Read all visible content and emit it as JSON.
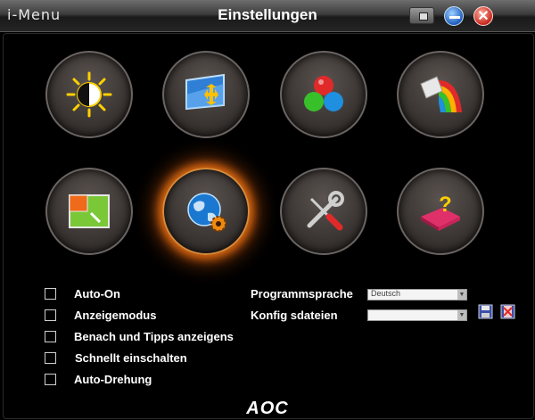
{
  "window": {
    "app_name": "i-Menu",
    "title": "Einstellungen",
    "close_glyph": "✕"
  },
  "tiles": [
    {
      "icon": "brightness-icon"
    },
    {
      "icon": "picture-boost-icon"
    },
    {
      "icon": "color-balls-icon"
    },
    {
      "icon": "color-paint-icon"
    },
    {
      "icon": "pip-window-icon"
    },
    {
      "icon": "globe-gear-icon",
      "active": true
    },
    {
      "icon": "tools-icon"
    },
    {
      "icon": "help-book-icon"
    }
  ],
  "checkboxes": [
    {
      "label": "Auto-On",
      "checked": false
    },
    {
      "label": "Anzeigemodus",
      "checked": false
    },
    {
      "label": "Benach und Tipps anzeigens",
      "checked": false
    },
    {
      "label": "Schnellt einschalten",
      "checked": false
    },
    {
      "label": "Auto-Drehung",
      "checked": false
    }
  ],
  "language": {
    "label": "Programmsprache",
    "value": "Deutsch"
  },
  "config": {
    "label": "Konfig sdateien",
    "value": ""
  },
  "logo": "AOC",
  "colors": {
    "accent_glow": "#e06a10",
    "background": "#000000"
  }
}
